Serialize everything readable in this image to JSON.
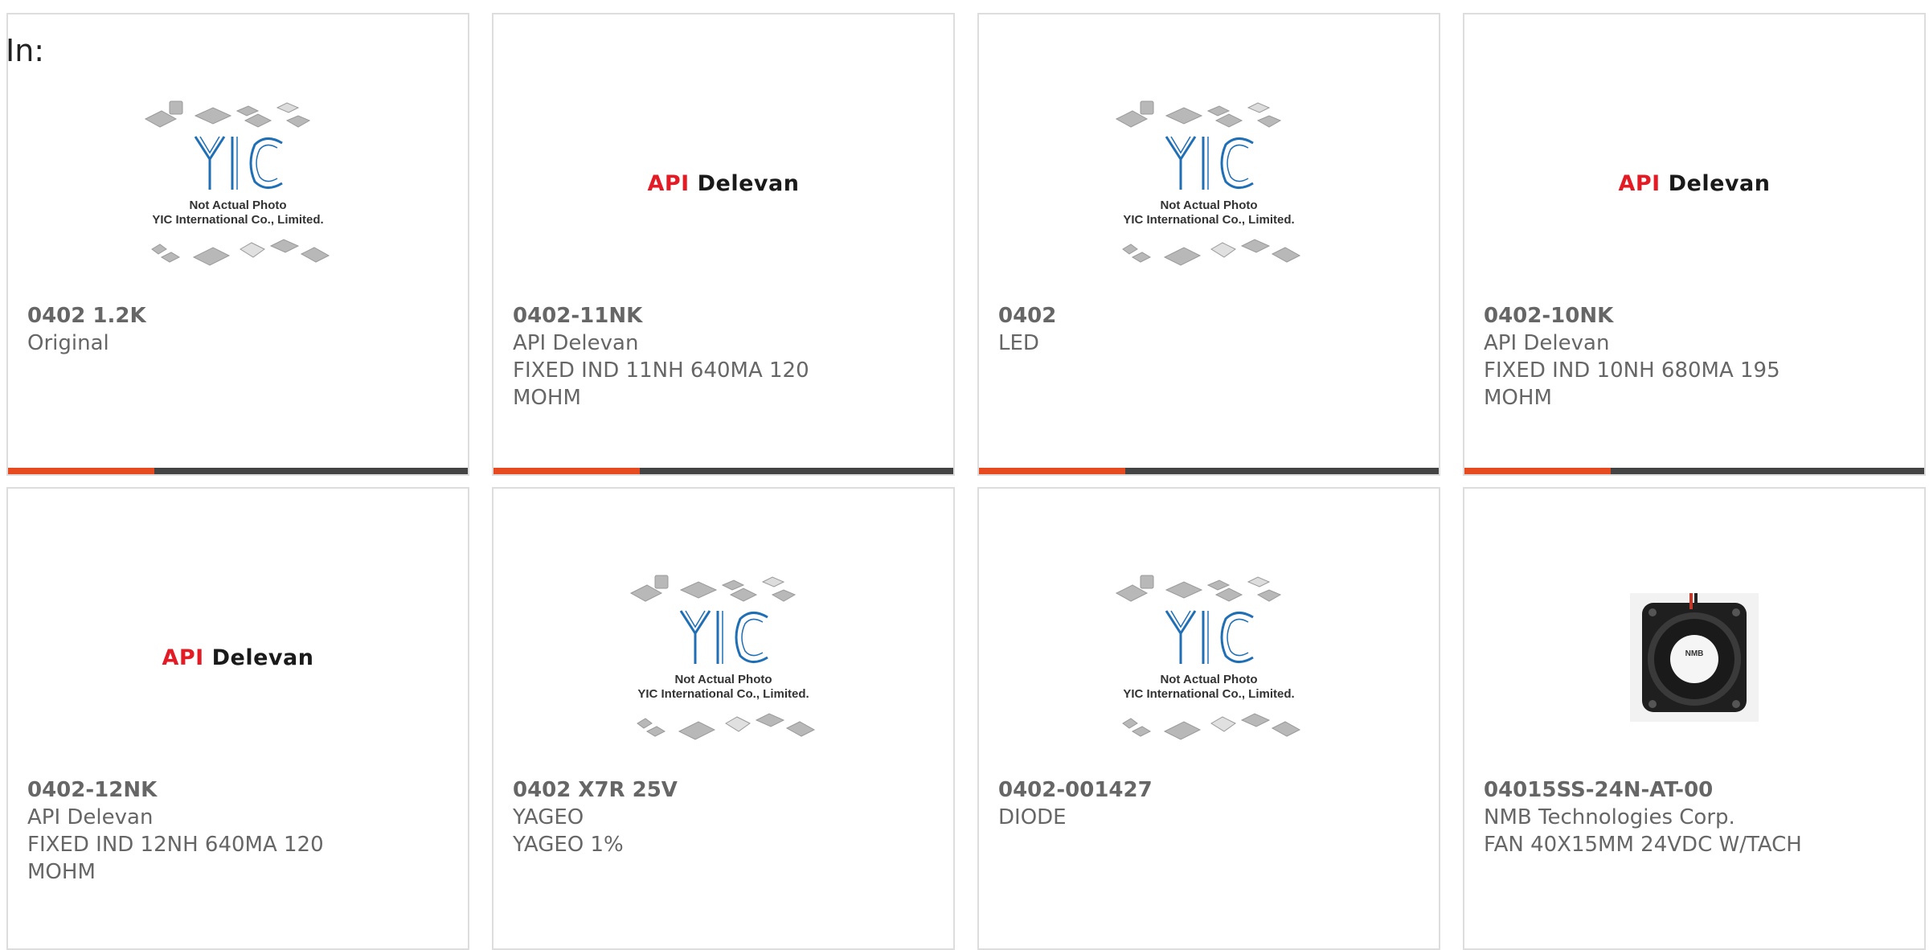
{
  "page": {
    "in_label": "In:"
  },
  "colors": {
    "accent": "#e84a1f",
    "bar": "#444444",
    "api_red": "#e21b25",
    "yic_blue": "#1e6fb5"
  },
  "yic_placeholder": {
    "logo_text": "YIC",
    "line1": "Not Actual Photo",
    "line2": "YIC International Co., Limited."
  },
  "api_logo": {
    "part1": "API",
    "part2": "Delevan"
  },
  "fan_label": "NMB",
  "products": [
    {
      "name": "0402 1.2K",
      "lines": [
        "Original"
      ],
      "image": "yic-placeholder",
      "bar": true
    },
    {
      "name": "0402-11NK",
      "lines": [
        "API Delevan",
        "FIXED IND 11NH 640MA 120",
        "MOHM"
      ],
      "image": "api-delevan-logo",
      "bar": true
    },
    {
      "name": "0402",
      "lines": [
        "LED"
      ],
      "image": "yic-placeholder",
      "bar": true
    },
    {
      "name": "0402-10NK",
      "lines": [
        "API Delevan",
        "FIXED IND 10NH 680MA 195",
        "MOHM"
      ],
      "image": "api-delevan-logo",
      "bar": true
    },
    {
      "name": "0402-12NK",
      "lines": [
        "API Delevan",
        "FIXED IND 12NH 640MA 120",
        "MOHM"
      ],
      "image": "api-delevan-logo",
      "bar": false
    },
    {
      "name": "0402 X7R 25V",
      "lines": [
        "YAGEO",
        "YAGEO 1%"
      ],
      "image": "yic-placeholder",
      "bar": false
    },
    {
      "name": "0402-001427",
      "lines": [
        "DIODE"
      ],
      "image": "yic-placeholder",
      "bar": false
    },
    {
      "name": "04015SS-24N-AT-00",
      "lines": [
        "NMB Technologies Corp.",
        "FAN 40X15MM 24VDC W/TACH"
      ],
      "image": "fan-photo",
      "bar": false
    }
  ]
}
